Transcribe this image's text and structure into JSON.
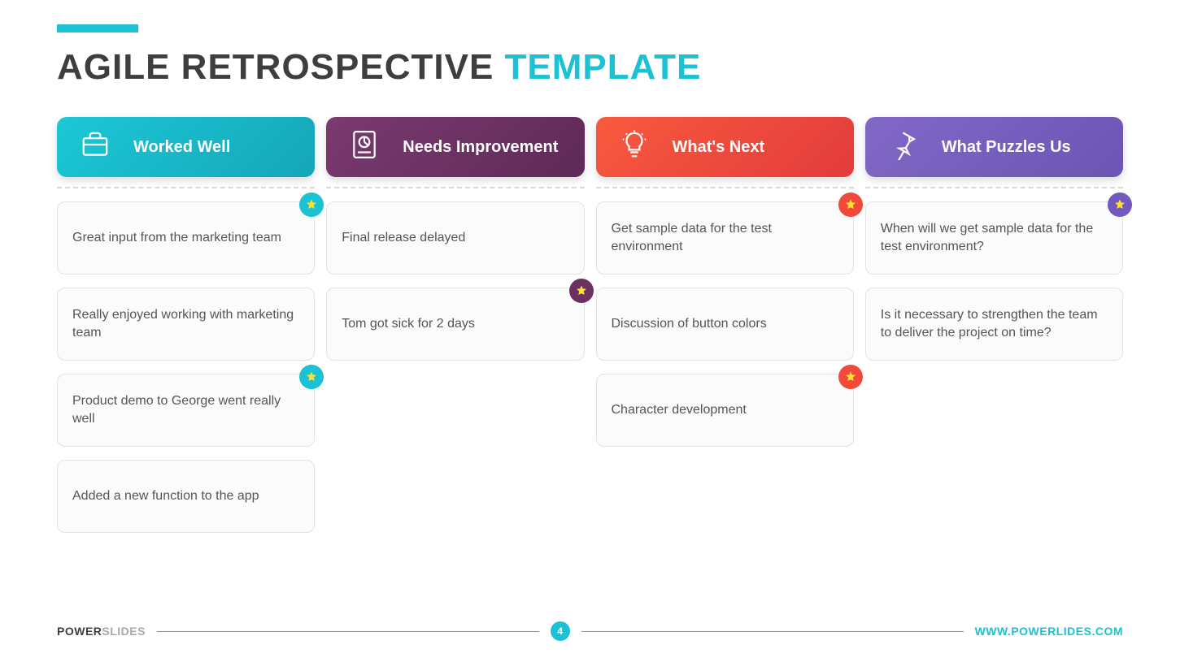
{
  "title": {
    "main": "AGILE RETROSPECTIVE ",
    "accent": "TEMPLATE"
  },
  "columns": [
    {
      "label": "Worked Well",
      "color": "teal",
      "cards": [
        {
          "text": "Great input from the marketing team",
          "starred": true
        },
        {
          "text": "Really enjoyed working with marketing team",
          "starred": false
        },
        {
          "text": "Product demo to George went really well",
          "starred": true
        },
        {
          "text": "Added a new function to the app",
          "starred": false
        }
      ]
    },
    {
      "label": "Needs Improvement",
      "color": "purple",
      "cards": [
        {
          "text": "Final release delayed",
          "starred": false
        },
        {
          "text": "Tom got sick for 2 days",
          "starred": true
        }
      ]
    },
    {
      "label": "What's Next",
      "color": "red",
      "cards": [
        {
          "text": "Get sample data for the test environment",
          "starred": true
        },
        {
          "text": "Discussion of button colors",
          "starred": false
        },
        {
          "text": "Character development",
          "starred": true
        }
      ]
    },
    {
      "label": "What Puzzles Us",
      "color": "violet",
      "cards": [
        {
          "text": "When will we get sample data for the test environment?",
          "starred": true
        },
        {
          "text": "Is it necessary to strengthen the team to deliver the project on time?",
          "starred": false
        }
      ]
    }
  ],
  "footer": {
    "brand_main": "POWER",
    "brand_light": "SLIDES",
    "page": "4",
    "url": "WWW.POWERLIDES.COM"
  },
  "icons": {
    "briefcase": "briefcase-icon",
    "chart": "pie-doc-icon",
    "bulb": "lightbulb-icon",
    "pin": "pushpin-icon",
    "star": "star-icon"
  }
}
